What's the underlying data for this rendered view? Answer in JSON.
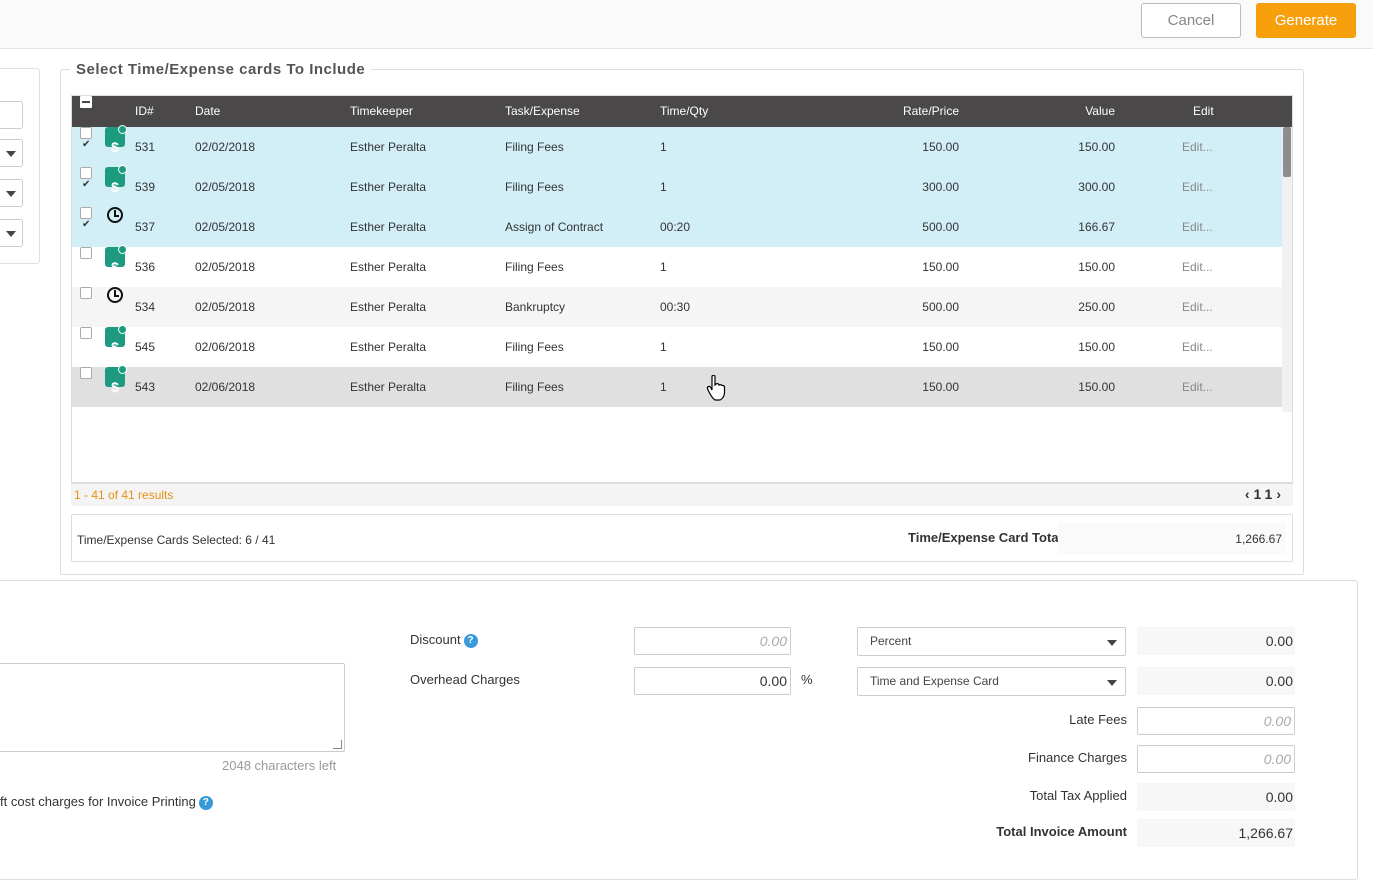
{
  "toolbar": {
    "cancel_label": "Cancel",
    "generate_label": "Generate",
    "accent_color": "#f7a00c"
  },
  "section": {
    "legend": "Select Time/Expense cards To Include"
  },
  "grid": {
    "columns": [
      "ID#",
      "Date",
      "Timekeeper",
      "Task/Expense",
      "Time/Qty",
      "Rate/Price",
      "Value",
      "Edit"
    ],
    "rows": [
      {
        "checked": true,
        "type": "expense",
        "id": "531",
        "date": "02/02/2018",
        "timekeeper": "Esther Peralta",
        "task": "Filing Fees",
        "qty": "1",
        "rate": "150.00",
        "value": "150.00",
        "edit": "Edit..."
      },
      {
        "checked": true,
        "type": "expense",
        "id": "539",
        "date": "02/05/2018",
        "timekeeper": "Esther Peralta",
        "task": "Filing Fees",
        "qty": "1",
        "rate": "300.00",
        "value": "300.00",
        "edit": "Edit..."
      },
      {
        "checked": true,
        "type": "time",
        "id": "537",
        "date": "02/05/2018",
        "timekeeper": "Esther Peralta",
        "task": "Assign of Contract",
        "qty": "00:20",
        "rate": "500.00",
        "value": "166.67",
        "edit": "Edit..."
      },
      {
        "checked": false,
        "type": "expense",
        "id": "536",
        "date": "02/05/2018",
        "timekeeper": "Esther Peralta",
        "task": "Filing Fees",
        "qty": "1",
        "rate": "150.00",
        "value": "150.00",
        "edit": "Edit..."
      },
      {
        "checked": false,
        "type": "time",
        "id": "534",
        "date": "02/05/2018",
        "timekeeper": "Esther Peralta",
        "task": "Bankruptcy",
        "qty": "00:30",
        "rate": "500.00",
        "value": "250.00",
        "edit": "Edit..."
      },
      {
        "checked": false,
        "type": "expense",
        "id": "545",
        "date": "02/06/2018",
        "timekeeper": "Esther Peralta",
        "task": "Filing Fees",
        "qty": "1",
        "rate": "150.00",
        "value": "150.00",
        "edit": "Edit..."
      },
      {
        "checked": false,
        "type": "expense",
        "id": "543",
        "date": "02/06/2018",
        "timekeeper": "Esther Peralta",
        "task": "Filing Fees",
        "qty": "1",
        "rate": "150.00",
        "value": "150.00",
        "edit": "Edit..."
      }
    ],
    "results_text": "1 - 41 of 41 results",
    "page_current": "1",
    "page_total": "1"
  },
  "summary": {
    "selected_text": "Time/Expense Cards Selected: 6 / 41",
    "total_label": "Time/Expense Card Total",
    "total_value": "1,266.67"
  },
  "invoice": {
    "discount_label": "Discount",
    "discount_placeholder": "0.00",
    "discount_type": "Percent",
    "discount_amount": "0.00",
    "overhead_label": "Overhead Charges",
    "overhead_value": "0.00",
    "overhead_unit": "%",
    "overhead_type": "Time and Expense Card",
    "overhead_amount": "0.00",
    "late_fees_label": "Late Fees",
    "late_fees_placeholder": "0.00",
    "finance_label": "Finance Charges",
    "finance_placeholder": "0.00",
    "tax_label": "Total Tax Applied",
    "tax_value": "0.00",
    "total_label": "Total Invoice Amount",
    "total_value": "1,266.67",
    "chars_left": "2048 characters left",
    "printing_option": "ft cost charges for Invoice Printing"
  }
}
